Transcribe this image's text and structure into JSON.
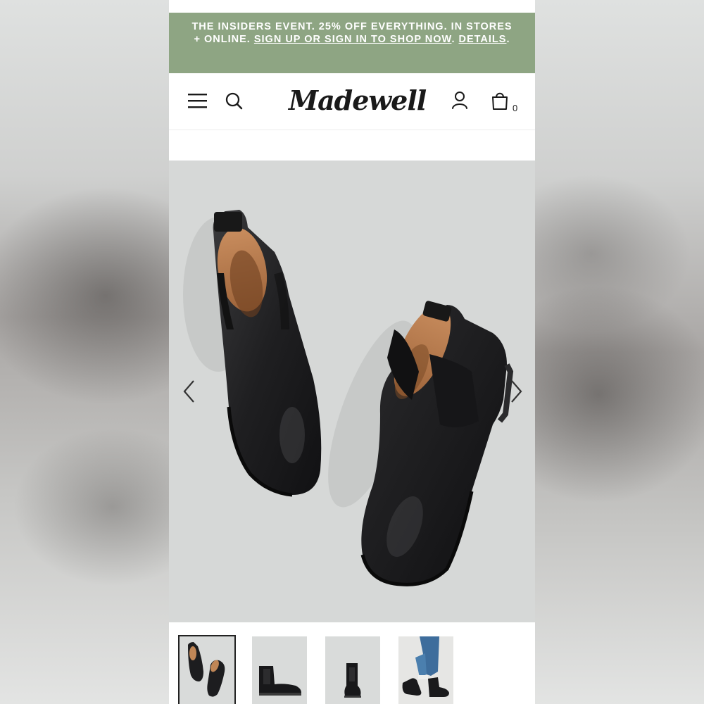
{
  "promo": {
    "text": "THE INSIDERS EVENT. 25% OFF EVERYTHING. IN STORES + ONLINE. ",
    "signup_link": "SIGN UP OR SIGN IN TO SHOP NOW",
    "separator": ". ",
    "details_link": "DETAILS",
    "end": "."
  },
  "header": {
    "logo": "Madewell",
    "bag_count": "0",
    "icons": [
      "menu-icon",
      "search-icon",
      "account-icon",
      "bag-icon"
    ]
  },
  "gallery": {
    "main_image": "black chelsea boots top view",
    "thumbnails": [
      "boots-top-view",
      "boot-side-view",
      "boot-front-view",
      "boots-worn-with-jeans"
    ],
    "active_index": 0
  },
  "colors": {
    "promo_bg": "#8ea583",
    "hero_bg": "#d6d8d7"
  }
}
